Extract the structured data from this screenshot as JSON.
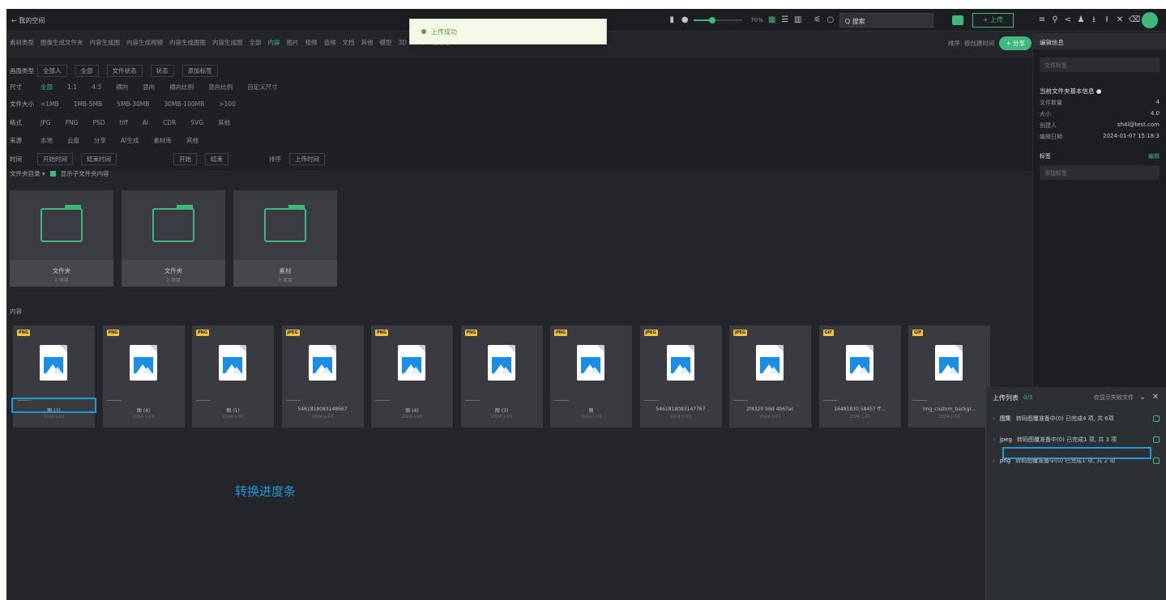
{
  "topbar": {
    "back_label": "← 我的空间",
    "search_text": "Q 搜索",
    "zoom": "70%",
    "upload_label": "+ 上传"
  },
  "toast": {
    "text": "上传成功"
  },
  "tabs": [
    "素材类型",
    "图像生成文件夹",
    "内容生成图",
    "内容生成视频",
    "内容生成图图",
    "内容生成图",
    "全部",
    "内容",
    "图片",
    "视频",
    "音频",
    "文档",
    "其他",
    "模型",
    "3D",
    "字体",
    "压缩包"
  ],
  "sort": {
    "label": "排序: 按创建时间",
    "share_label": "+ 分享"
  },
  "filters": {
    "row1": {
      "label": "画面类型",
      "items": [
        "全部人",
        "全部",
        "文件状态",
        "状态",
        "添加标签"
      ]
    },
    "row2": {
      "label": "尺寸",
      "items": [
        "全部",
        "1:1",
        "4:3",
        "横向",
        "竖向",
        "横向比例",
        "竖向比例",
        "自定义尺寸"
      ]
    },
    "row3": {
      "label": "文件大小",
      "items": [
        "<1MB",
        "1MB-5MB",
        "5MB-30MB",
        "30MB-100MB",
        ">100"
      ]
    },
    "row4": {
      "label": "格式",
      "items": [
        "JPG",
        "PNG",
        "PSD",
        "tiff",
        "AI",
        "CDR",
        "SVG",
        "其他"
      ]
    },
    "row5": {
      "label": "来源",
      "items": [
        "本地",
        "云盘",
        "分享",
        "AI生成",
        "素材库",
        "其他"
      ]
    },
    "row6": {
      "label": "时间",
      "items": [
        "开始时间",
        "结束时间",
        "开始",
        "结束"
      ],
      "extra_label": "排序",
      "extra_value": "上传时间"
    }
  },
  "folder_section": {
    "label": "文件夹目录 ▾",
    "toggle": "显示子文件夹内容"
  },
  "folders": [
    {
      "name": "文件夹",
      "sub": "1 项目"
    },
    {
      "name": "文件夹",
      "sub": "2 项目"
    },
    {
      "name": "素材",
      "sub": "3 项目"
    }
  ],
  "content_label": "内容",
  "tiles": [
    {
      "badge": "PNG",
      "name": "图 (2)",
      "sub": "2024-1-03"
    },
    {
      "badge": "PNG",
      "name": "图 (4)",
      "sub": "2024-1-03"
    },
    {
      "badge": "PNG",
      "name": "图 (1)",
      "sub": "2024-1-03"
    },
    {
      "badge": "JPEG",
      "name": "5461818083148667",
      "sub": "2024-1-03"
    },
    {
      "badge": "PNG",
      "name": "图 (4)",
      "sub": "2024-1-03"
    },
    {
      "badge": "PNG",
      "name": "图 (3)",
      "sub": "2024-1-03"
    },
    {
      "badge": "PNG",
      "name": "图",
      "sub": "2024-1-03"
    },
    {
      "badge": "JPEG",
      "name": "5461818083147767",
      "sub": "2024-1-03"
    },
    {
      "badge": "JPEG",
      "name": "2f4320 b9d 4b67ac",
      "sub": "2024-1-03"
    },
    {
      "badge": "GIF",
      "name": "16481830 58457 ff...",
      "sub": "2024-1-03"
    },
    {
      "badge": "GIF",
      "name": "img_custom_backgr...",
      "sub": "2024-1-03"
    }
  ],
  "annotation": "转换进度条",
  "rpanel": {
    "title": "编辑信息",
    "search_placeholder": "文件标签",
    "section": "当前文件夹基本信息 ●",
    "kv": [
      {
        "k": "文件数量",
        "v": "4"
      },
      {
        "k": "大小",
        "v": "4.0"
      },
      {
        "k": "创建人",
        "v": "sh4l@test.com"
      },
      {
        "k": "编辑日期",
        "v": "2024-01-07 15:18:3"
      }
    ],
    "tag_label": "标签",
    "tag_action": "编辑",
    "tag_placeholder": "添加标签"
  },
  "upload_list": {
    "title": "上传列表",
    "count": "0/3",
    "right": "仅显示失败文件",
    "rows": [
      {
        "type": "图集",
        "status": "转码图覆准备中(0) 已完成4 项, 共 6项"
      },
      {
        "type": "jpeg",
        "status": "转码图覆准备中(0) 已完成1 项, 共 3 项"
      },
      {
        "type": "png",
        "status": "转码图覆准备中(0) 已完成1 项, 共 2 项"
      }
    ]
  }
}
